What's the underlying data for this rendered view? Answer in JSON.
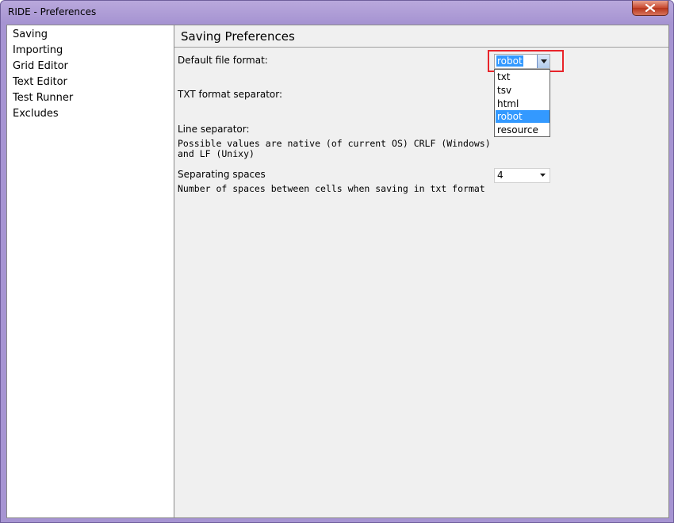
{
  "window": {
    "title": "RIDE - Preferences"
  },
  "tree": {
    "items": [
      "Saving",
      "Importing",
      "Grid Editor",
      "Text Editor",
      "Test Runner",
      "Excludes"
    ]
  },
  "panel": {
    "title": "Saving Preferences",
    "default_format": {
      "label": "Default file format:",
      "value": "robot",
      "options": [
        "txt",
        "tsv",
        "html",
        "robot",
        "resource"
      ],
      "selected_index": 3
    },
    "txt_separator": {
      "label": "TXT format separator:"
    },
    "line_separator": {
      "label": "Line separator:",
      "help_line1": "Possible values are native (of current OS) CRLF (Windows)",
      "help_line2": "and LF (Unixy)"
    },
    "separating_spaces": {
      "label": "Separating spaces",
      "help": "Number of spaces between cells when saving in txt format",
      "value": "4"
    }
  },
  "colors": {
    "selection": "#3399ff",
    "highlight_box": "#e8242a",
    "close_button": "#c8482f",
    "frame": "#a694d2"
  }
}
